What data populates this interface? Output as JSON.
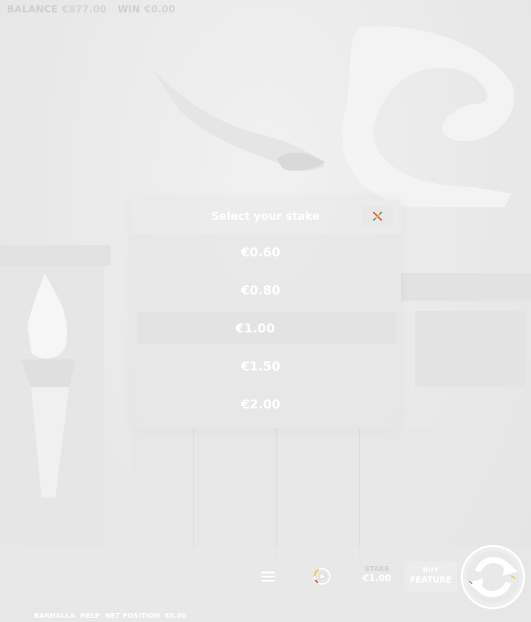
{
  "topbar": {
    "balance_label": "BALANCE",
    "balance_value": "€877.00",
    "win_label": "WIN",
    "win_value": "€0.00"
  },
  "stake_modal": {
    "title": "Select your stake",
    "options": [
      "€0.60",
      "€0.80",
      "€1.00",
      "€1.50",
      "€2.00"
    ],
    "selected_value": "€1.00"
  },
  "controls": {
    "stake_label": "STAKE",
    "stake_value": "€1.00",
    "buy_feature_line1": "BUY",
    "buy_feature_line2": "FEATURE"
  },
  "footer": {
    "game_name": "BARHALLA",
    "help_label": "HELP",
    "net_position_label": "NET POSITION",
    "net_position_value": "€0.00"
  },
  "icons": {
    "close": "close-icon",
    "menu": "hamburger-menu-icon",
    "autoplay": "autoplay-icon",
    "spin": "spin-arrows-icon"
  },
  "colors": {
    "text": "#ffffff",
    "muted_text": "#d0d0d0",
    "background": "#ebebeb"
  }
}
